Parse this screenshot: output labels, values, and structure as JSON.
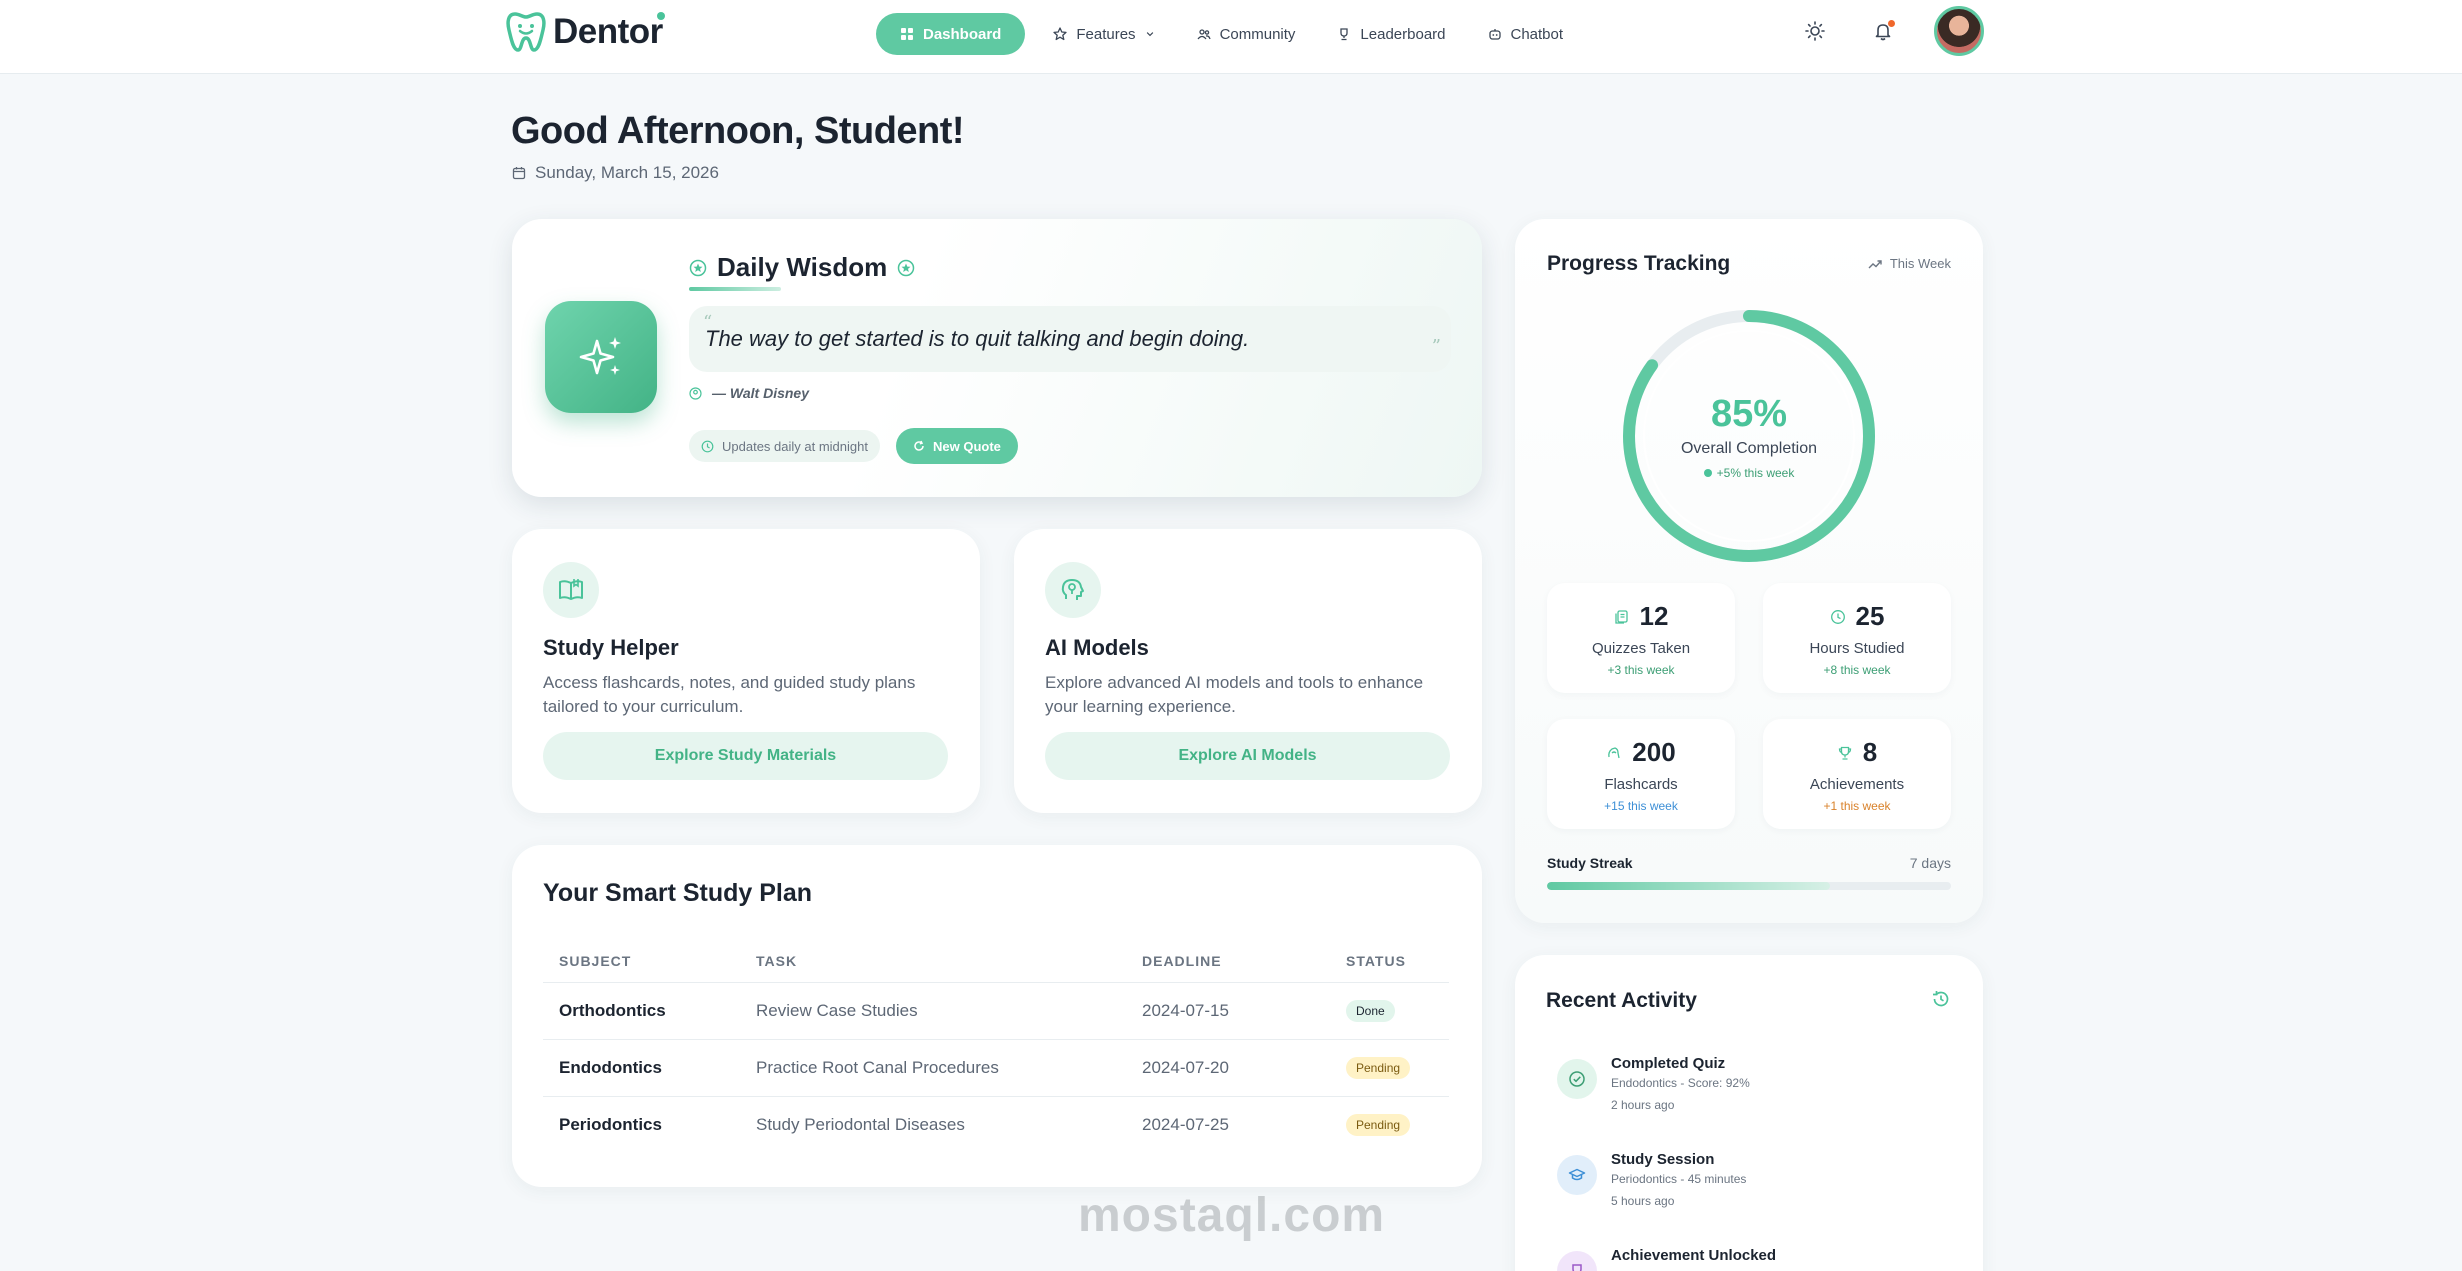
{
  "brand": {
    "name": "Dentor",
    "accent": "#5fc9a2"
  },
  "nav": {
    "dashboard": "Dashboard",
    "features": "Features",
    "community": "Community",
    "leaderboard": "Leaderboard",
    "chatbot": "Chatbot"
  },
  "header": {
    "greeting": "Good Afternoon, Student!",
    "date": "Sunday, March 15, 2026"
  },
  "wisdom": {
    "title": "Daily Wisdom",
    "quote": "The way to get started is to quit talking and begin doing.",
    "author": "— Walt Disney",
    "update_note": "Updates daily at midnight",
    "new_quote_label": "New Quote"
  },
  "features": [
    {
      "title": "Study Helper",
      "description": "Access flashcards, notes, and guided study plans tailored to your curriculum.",
      "button": "Explore Study Materials",
      "icon": "book-icon"
    },
    {
      "title": "AI Models",
      "description": "Explore advanced AI models and tools to enhance your learning experience.",
      "button": "Explore AI Models",
      "icon": "brain-icon"
    }
  ],
  "study_plan": {
    "title": "Your Smart Study Plan",
    "columns": [
      "SUBJECT",
      "TASK",
      "DEADLINE",
      "STATUS"
    ],
    "rows": [
      {
        "subject": "Orthodontics",
        "task": "Review Case Studies",
        "deadline": "2024-07-15",
        "status": "Done"
      },
      {
        "subject": "Endodontics",
        "task": "Practice Root Canal Procedures",
        "deadline": "2024-07-20",
        "status": "Pending"
      },
      {
        "subject": "Periodontics",
        "task": "Study Periodontal Diseases",
        "deadline": "2024-07-25",
        "status": "Pending"
      }
    ]
  },
  "progress": {
    "title": "Progress Tracking",
    "range": "This Week",
    "completion_value": 85,
    "completion_pct": "85%",
    "completion_label": "Overall Completion",
    "completion_delta": "+5% this week",
    "stats": [
      {
        "value": "12",
        "label": "Quizzes Taken",
        "delta": "+3 this week",
        "delta_color": "#3c9e74",
        "icon": "quiz-icon"
      },
      {
        "value": "25",
        "label": "Hours Studied",
        "delta": "+8 this week",
        "delta_color": "#3c9e74",
        "icon": "clock-icon"
      },
      {
        "value": "200",
        "label": "Flashcards",
        "delta": "+15 this week",
        "delta_color": "#3d8fd6",
        "icon": "flashcard-icon"
      },
      {
        "value": "8",
        "label": "Achievements",
        "delta": "+1 this week",
        "delta_color": "#d9822b",
        "icon": "trophy-icon"
      }
    ],
    "streak_label": "Study Streak",
    "streak_value": "7 days",
    "streak_fraction": 0.7
  },
  "activity": {
    "title": "Recent Activity",
    "items": [
      {
        "title": "Completed Quiz",
        "subtitle": "Endodontics - Score: 92%",
        "time": "2 hours ago",
        "icon": "check-circle-icon",
        "color": "#e2f5ec",
        "fg": "#3c9e74"
      },
      {
        "title": "Study Session",
        "subtitle": "Periodontics - 45 minutes",
        "time": "5 hours ago",
        "icon": "graduation-cap-icon",
        "color": "#e1eefa",
        "fg": "#3d8fd6"
      },
      {
        "title": "Achievement Unlocked",
        "subtitle": "",
        "time": "",
        "icon": "trophy-icon",
        "color": "#f1e5fa",
        "fg": "#9b59c8"
      }
    ]
  },
  "watermark": "mostaql.com"
}
